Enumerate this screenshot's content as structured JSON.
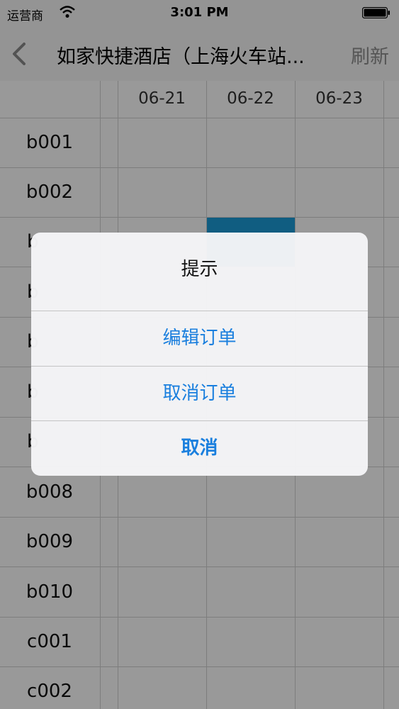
{
  "status_bar": {
    "carrier": "运营商",
    "time": "3:01 PM",
    "wifi_icon": "wifi-icon",
    "battery_icon": "battery-icon"
  },
  "nav": {
    "back_icon": "chevron-left-icon",
    "title": "如家快捷酒店（上海火车站...",
    "refresh_label": "刷新"
  },
  "grid": {
    "dates": [
      "06-21",
      "06-22",
      "06-23"
    ],
    "rooms": [
      "b001",
      "b002",
      "b",
      "b",
      "b",
      "b",
      "b",
      "b008",
      "b009",
      "b010",
      "c001",
      "c002"
    ],
    "booked_cell": {
      "room": "b003",
      "date": "06-22"
    },
    "booked_color": "#1b9bd8"
  },
  "alert": {
    "title": "提示",
    "actions": [
      {
        "label": "编辑订单"
      },
      {
        "label": "取消订单"
      },
      {
        "label": "取消"
      }
    ],
    "action_color": "#1a7fde"
  }
}
